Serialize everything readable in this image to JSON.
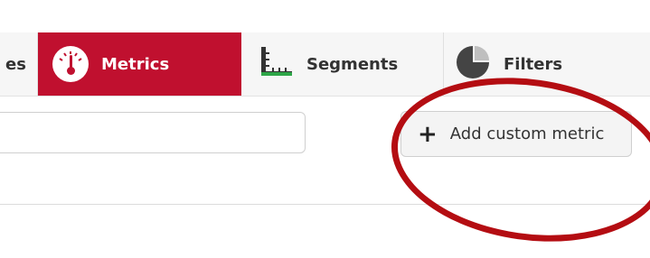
{
  "tabs": [
    {
      "label": "es",
      "icon": "",
      "active": false
    },
    {
      "label": "Metrics",
      "icon": "speedometer-icon",
      "active": true
    },
    {
      "label": "Segments",
      "icon": "ruler-icon",
      "active": false
    },
    {
      "label": "Filters",
      "icon": "pie-chart-icon",
      "active": false
    }
  ],
  "search": {
    "value": "",
    "placeholder": ""
  },
  "toolbar": {
    "add_label": "Add custom metric",
    "add_icon": "plus-icon"
  },
  "annotation": {
    "color": "#b40d12",
    "shape": "ellipse"
  },
  "colors": {
    "accent": "#c0102f"
  }
}
